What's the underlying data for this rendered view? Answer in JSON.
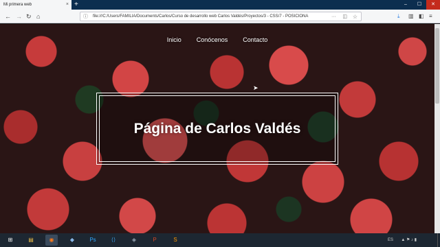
{
  "browser": {
    "tab_title": "Mi primera web",
    "tab_close": "×",
    "new_tab": "+",
    "url": "file:///C:/Users/FAMILIA/Documents/Carlos/Curso de desarrollo web Carlos Valdés/Proyectos/3 - CSS/7 - POSICIONA",
    "window_buttons": [
      "–",
      "☐",
      "✕"
    ],
    "nav_icons": {
      "back": "←",
      "forward": "→",
      "reload": "↻",
      "home": "⌂"
    },
    "url_icons": {
      "info": "ⓘ",
      "more": "···",
      "pocket": "◫",
      "star": "☆"
    },
    "toolbar_icons": {
      "downloads": "⤓",
      "library": "▥",
      "sidebar": "◧",
      "menu": "≡"
    }
  },
  "page": {
    "nav": [
      "Inicio",
      "Conócenos",
      "Contacto"
    ],
    "hero_title": "Página de Carlos Valdés"
  },
  "taskbar": {
    "apps": [
      {
        "icon": "windows-icon",
        "glyph": "⊞",
        "color": "#ffffff"
      },
      {
        "icon": "folder-icon",
        "glyph": "▤",
        "color": "#f3c24a"
      },
      {
        "icon": "firefox-icon",
        "glyph": "◉",
        "color": "#ff7a1a"
      },
      {
        "icon": "box-icon",
        "glyph": "◆",
        "color": "#8ab8e8"
      },
      {
        "icon": "photoshop-icon",
        "glyph": "Ps",
        "color": "#31a8ff"
      },
      {
        "icon": "vscode-icon",
        "glyph": "⟨⟩",
        "color": "#3aa0e8"
      },
      {
        "icon": "app-icon",
        "glyph": "◈",
        "color": "#9aa9b8"
      },
      {
        "icon": "powerpoint-icon",
        "glyph": "P",
        "color": "#d24726"
      },
      {
        "icon": "sublime-icon",
        "glyph": "S",
        "color": "#ff9800"
      }
    ],
    "language": "ES",
    "tray_icons": "▲ ⚑ ♪ ▮"
  }
}
